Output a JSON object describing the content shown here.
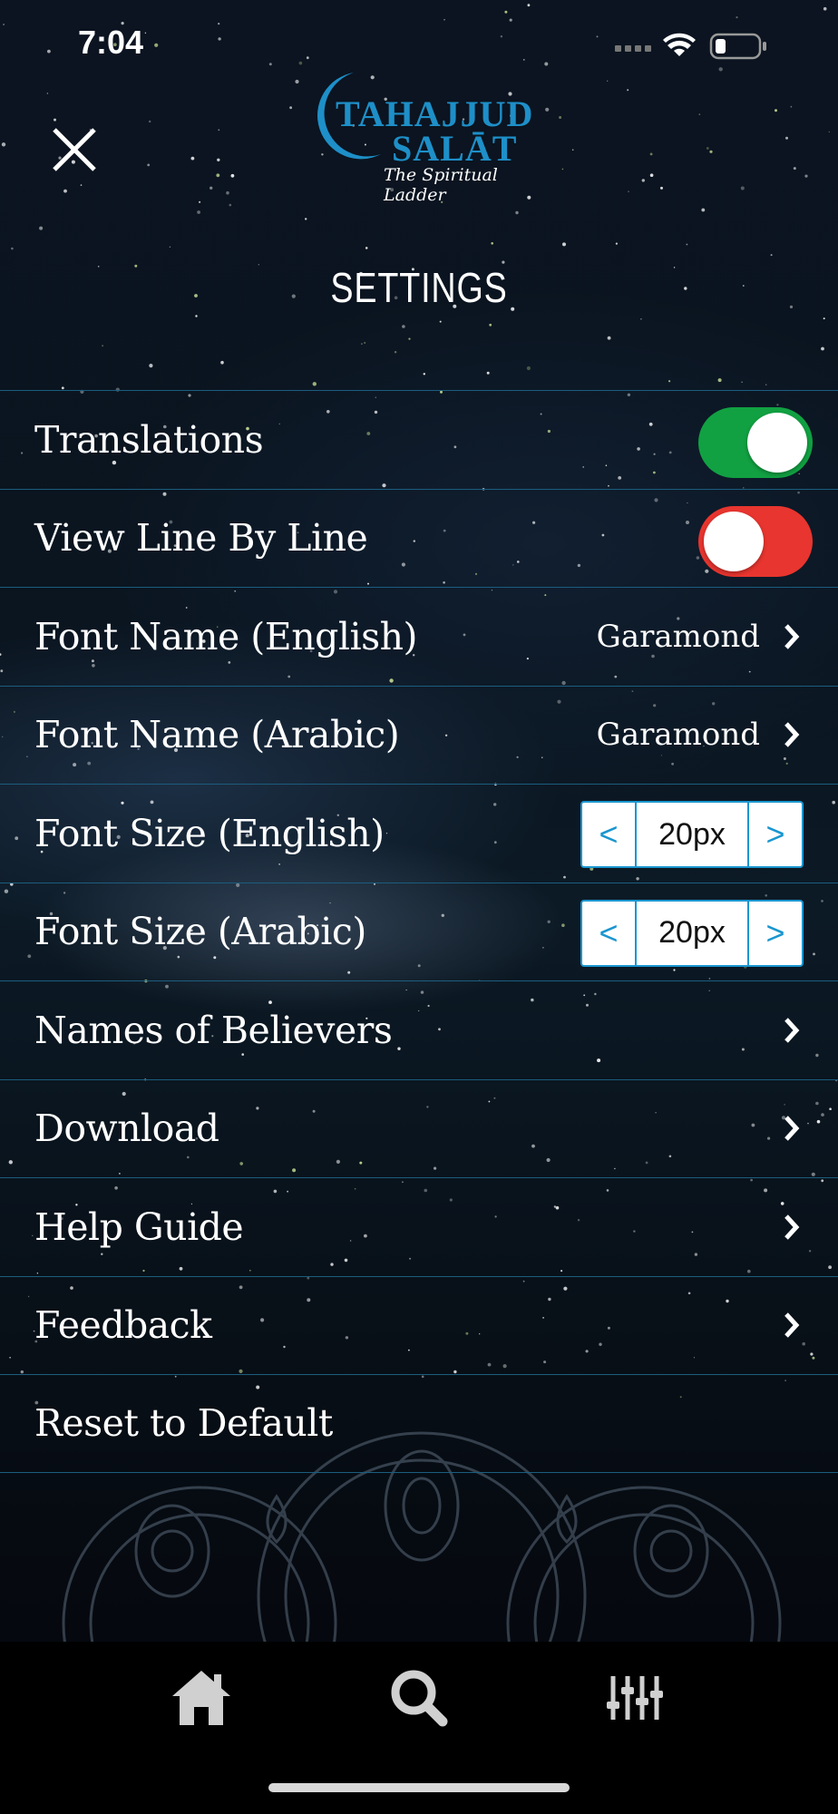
{
  "status_bar": {
    "time": "7:04"
  },
  "header": {
    "logo_line1": "TAHAJJUD",
    "logo_line2": "SALĀT",
    "logo_tagline": "The Spiritual Ladder",
    "title": "SETTINGS"
  },
  "settings": {
    "translations": {
      "label": "Translations",
      "enabled": true
    },
    "line_by_line": {
      "label": "View Line By Line",
      "enabled": false
    },
    "font_name_english": {
      "label": "Font Name (English)",
      "value": "Garamond"
    },
    "font_name_arabic": {
      "label": "Font Name (Arabic)",
      "value": "Garamond"
    },
    "font_size_english": {
      "label": "Font Size (English)",
      "value": "20px",
      "dec": "<",
      "inc": ">"
    },
    "font_size_arabic": {
      "label": "Font Size (Arabic)",
      "value": "20px",
      "dec": "<",
      "inc": ">"
    },
    "names_of_believers": {
      "label": "Names of Believers"
    },
    "download": {
      "label": "Download"
    },
    "help_guide": {
      "label": "Help Guide"
    },
    "feedback": {
      "label": "Feedback"
    },
    "reset": {
      "label": "Reset to Default"
    }
  },
  "tabs": [
    {
      "icon": "home-icon"
    },
    {
      "icon": "search-icon"
    },
    {
      "icon": "equalizer-icon"
    }
  ],
  "colors": {
    "toggle_on": "#11a142",
    "toggle_off": "#e8352f",
    "accent": "#1a96cf",
    "divider": "#1b5d7e"
  }
}
